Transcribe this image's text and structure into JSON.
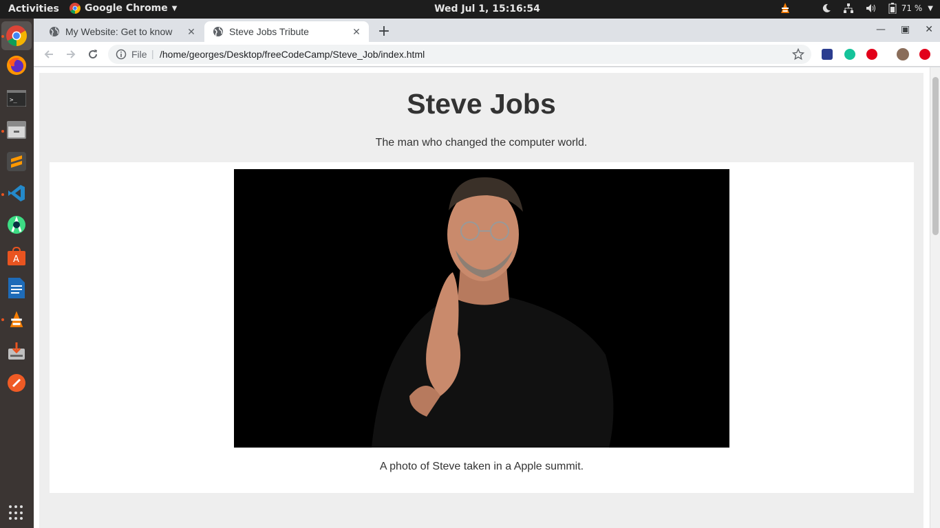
{
  "topbar": {
    "activities": "Activities",
    "app_name": "Google Chrome",
    "clock": "Wed Jul  1, 15:16:54",
    "battery": "71 %"
  },
  "dock": {
    "items": [
      "chrome",
      "firefox",
      "terminal",
      "files",
      "sublime-text",
      "vscode",
      "android-studio",
      "software-center",
      "libreoffice-writer",
      "vlc",
      "installer",
      "postman"
    ]
  },
  "browser": {
    "tabs": [
      {
        "title": "My Website: Get to know",
        "active": false
      },
      {
        "title": "Steve Jobs Tribute",
        "active": true
      }
    ],
    "omnibox": {
      "scheme": "File",
      "url": "/home/georges/Desktop/freeCodeCamp/Steve_Job/index.html"
    }
  },
  "page": {
    "title": "Steve Jobs",
    "subtitle": "The man who changed the computer world.",
    "image_caption": "A photo of Steve taken in a Apple summit."
  },
  "colors": {
    "page_bg": "#eeeeee",
    "text": "#333333",
    "dock_bg": "#3b3533",
    "ubuntu_orange": "#e95420"
  }
}
